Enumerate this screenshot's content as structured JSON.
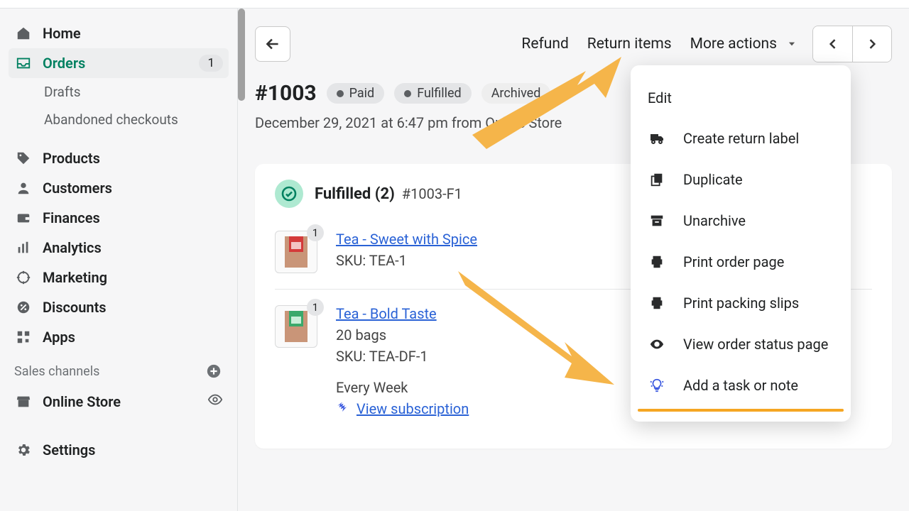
{
  "sidebar": {
    "home": "Home",
    "orders": "Orders",
    "orders_badge": "1",
    "drafts": "Drafts",
    "abandoned": "Abandoned checkouts",
    "products": "Products",
    "customers": "Customers",
    "finances": "Finances",
    "analytics": "Analytics",
    "marketing": "Marketing",
    "discounts": "Discounts",
    "apps": "Apps",
    "sales_channels": "Sales channels",
    "online_store": "Online Store",
    "settings": "Settings"
  },
  "topbar": {
    "refund": "Refund",
    "return": "Return items",
    "more": "More actions"
  },
  "order": {
    "title": "#1003",
    "badge_paid": "Paid",
    "badge_fulfilled": "Fulfilled",
    "badge_archived": "Archived",
    "subtitle": "December 29, 2021 at 6:47 pm from Online Store"
  },
  "fulfillment": {
    "title": "Fulfilled (2)",
    "code": "#1003-F1",
    "items": [
      {
        "qty": "1",
        "name": "Tea - Sweet with Spice",
        "sku": "SKU: TEA-1"
      },
      {
        "qty": "1",
        "name": "Tea - Bold Taste",
        "variant": "20 bags",
        "sku": "SKU: TEA-DF-1",
        "recurrence": "Every Week",
        "view_sub": "View subscription"
      }
    ]
  },
  "dropdown": {
    "edit": "Edit",
    "create_return": "Create return label",
    "duplicate": "Duplicate",
    "unarchive": "Unarchive",
    "print_order": "Print order page",
    "print_packing": "Print packing slips",
    "view_status": "View order status page",
    "add_task": "Add a task or note"
  }
}
